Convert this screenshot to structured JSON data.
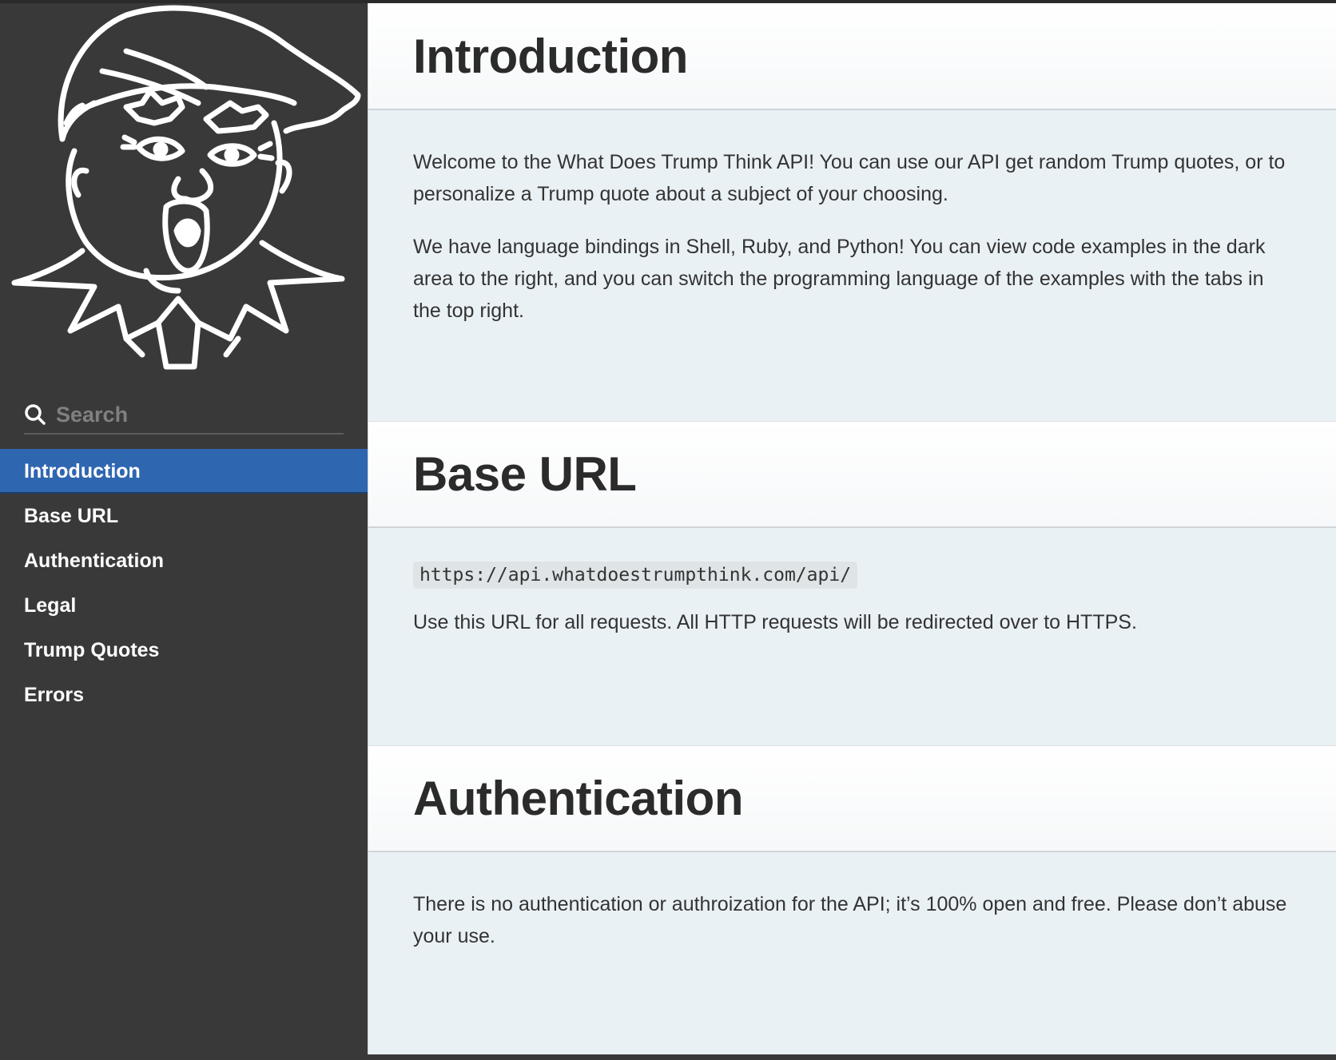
{
  "sidebar": {
    "search": {
      "placeholder": "Search"
    },
    "toc": [
      {
        "label": "Introduction",
        "active": true
      },
      {
        "label": "Base URL"
      },
      {
        "label": "Authentication"
      },
      {
        "label": "Legal"
      },
      {
        "label": "Trump Quotes"
      },
      {
        "label": "Errors"
      }
    ]
  },
  "sections": {
    "introduction": {
      "title": "Introduction",
      "paragraphs": [
        "Welcome to the What Does Trump Think API! You can use our API get random Trump quotes, or to personalize a Trump quote about a subject of your choosing.",
        "We have language bindings in Shell, Ruby, and Python! You can view code examples in the dark area to the right, and you can switch the programming language of the examples with the tabs in the top right."
      ]
    },
    "base_url": {
      "title": "Base URL",
      "url": "https://api.whatdoestrumpthink.com/api/",
      "note": "Use this URL for all requests. All HTTP requests will be redirected over to HTTPS."
    },
    "authentication": {
      "title": "Authentication",
      "text": "There is no authentication or authroization for the API; it’s 100% open and free. Please don’t abuse your use."
    }
  },
  "colors": {
    "sidebar_bg": "#393939",
    "active_item": "#2f66b0",
    "content_bg": "#eaf1f5"
  },
  "icons": [
    "trump-caricature-logo-icon",
    "search-icon"
  ]
}
